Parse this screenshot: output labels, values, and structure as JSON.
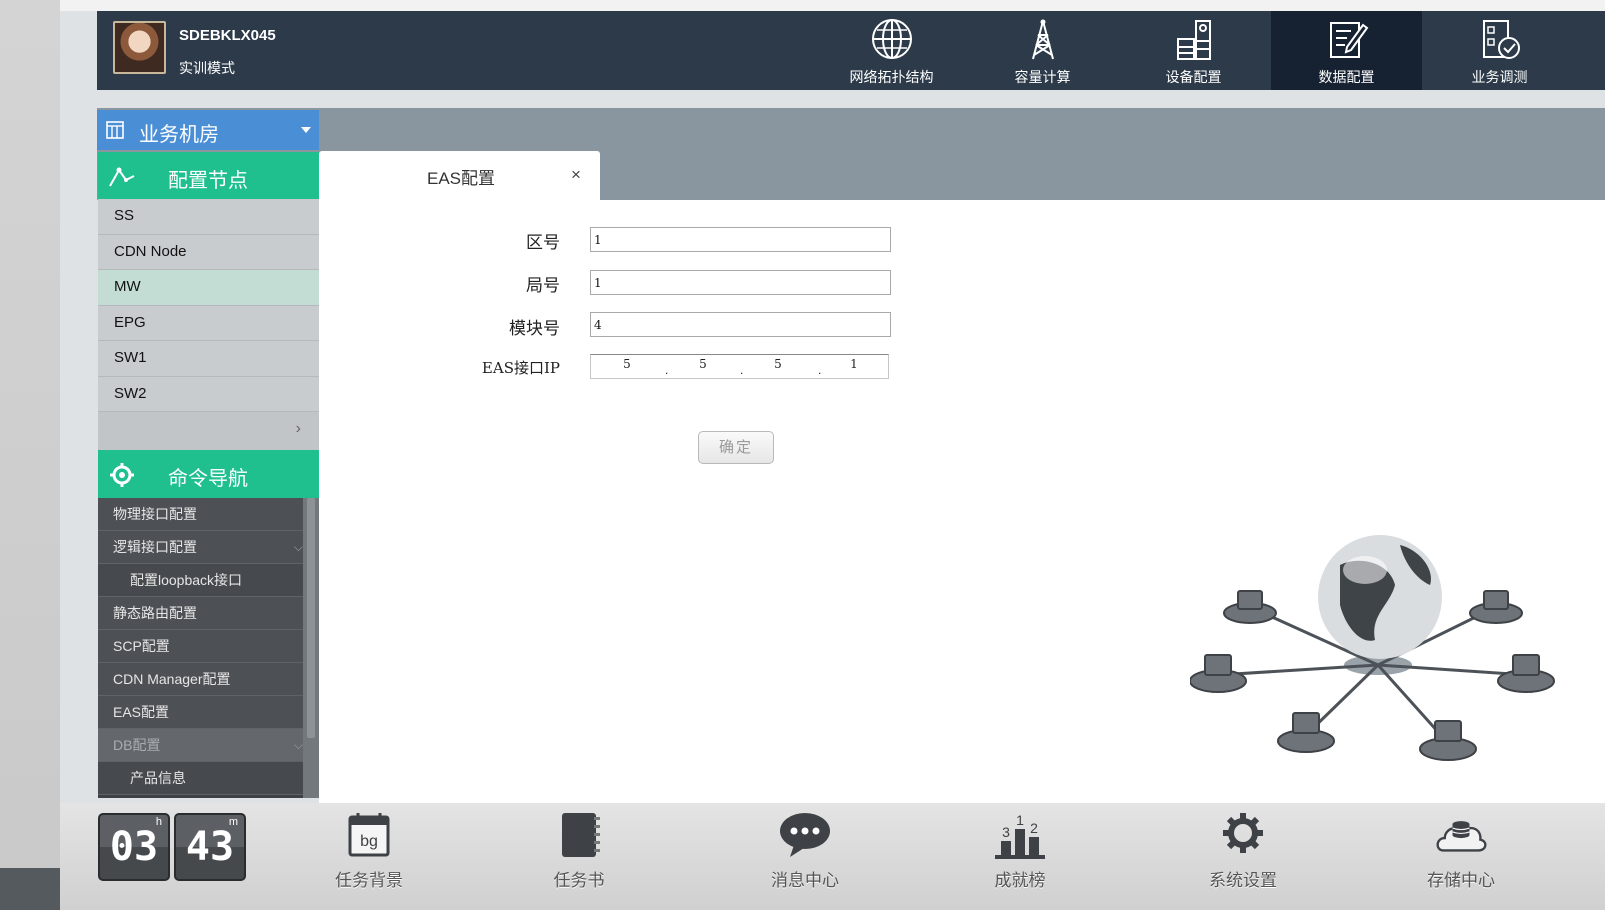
{
  "header": {
    "user_id": "SDEBKLX045",
    "mode": "实训模式",
    "nav": [
      {
        "label": "网络拓扑结构",
        "icon": "globe-icon"
      },
      {
        "label": "容量计算",
        "icon": "tower-icon"
      },
      {
        "label": "设备配置",
        "icon": "device-icon"
      },
      {
        "label": "数据配置",
        "icon": "data-edit-icon",
        "active": true
      },
      {
        "label": "业务调测",
        "icon": "service-check-icon"
      }
    ]
  },
  "room_selector": {
    "label": "业务机房"
  },
  "config_nodes": {
    "title": "配置节点",
    "items": [
      "SS",
      "CDN Node",
      "MW",
      "EPG",
      "SW1",
      "SW2"
    ],
    "active": "MW",
    "more": "›"
  },
  "command_nav": {
    "title": "命令导航",
    "items": [
      {
        "label": "物理接口配置"
      },
      {
        "label": "逻辑接口配置",
        "chevron": "⌵"
      },
      {
        "label": "配置loopback接口"
      },
      {
        "label": "静态路由配置"
      },
      {
        "label": "SCP配置"
      },
      {
        "label": "CDN Manager配置"
      },
      {
        "label": "EAS配置"
      },
      {
        "label": "DB配置",
        "chevron": "⌵"
      },
      {
        "label": "产品信息"
      }
    ]
  },
  "tab": {
    "label": "EAS配置",
    "close": "×"
  },
  "form": {
    "area_label": "区号",
    "area_value": "1",
    "office_label": "局号",
    "office_value": "1",
    "module_label": "模块号",
    "module_value": "4",
    "ip_label": "EAS接口IP",
    "ip_octets": [
      "5",
      "5",
      "5",
      "1"
    ],
    "confirm_label": "确定"
  },
  "footer": {
    "clock": {
      "hours": "03",
      "minutes": "43",
      "h_unit": "h",
      "m_unit": "m"
    },
    "nav": [
      {
        "label": "任务背景",
        "icon": "calendar-bg-icon",
        "icon_text": "bg"
      },
      {
        "label": "任务书",
        "icon": "notebook-icon"
      },
      {
        "label": "消息中心",
        "icon": "chat-icon"
      },
      {
        "label": "成就榜",
        "icon": "podium-icon",
        "icon_text": [
          "3",
          "1",
          "2"
        ]
      },
      {
        "label": "系统设置",
        "icon": "gear-icon"
      },
      {
        "label": "存储中心",
        "icon": "cloud-storage-icon"
      }
    ]
  },
  "colors": {
    "header_bg": "#2c3a4a",
    "header_active": "#162232",
    "room_blue": "#4a8fd6",
    "green_accent": "#1fbf8e",
    "band_gray": "#8a969f"
  }
}
